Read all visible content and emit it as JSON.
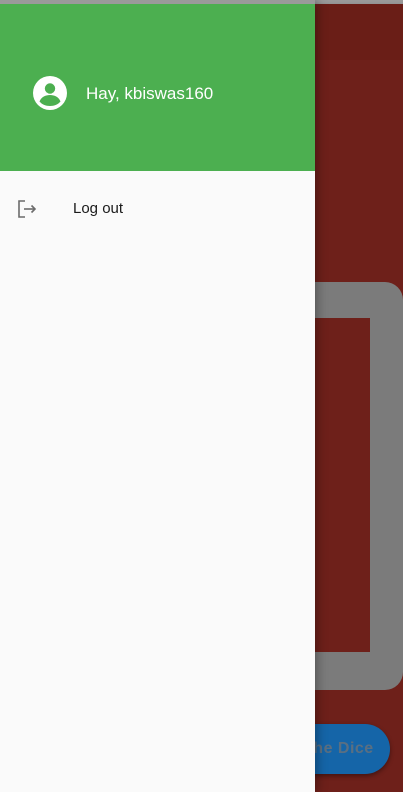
{
  "drawer": {
    "greeting": "Hay, kbiswas160",
    "items": [
      {
        "label": "Log out",
        "icon": "logout-icon"
      }
    ]
  },
  "background": {
    "roll_button_label": "Roll the Dice"
  },
  "colors": {
    "header_green": "#4caf50",
    "drawer_bg": "#fafafa",
    "page_red": "#6e201a",
    "button_blue": "#1565a8"
  }
}
